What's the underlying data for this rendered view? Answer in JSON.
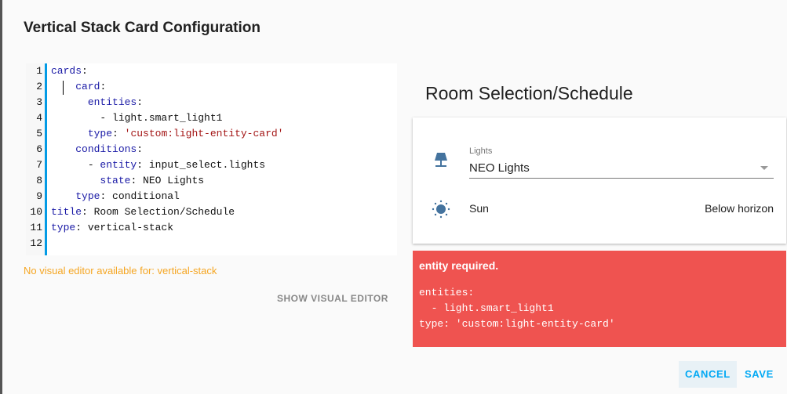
{
  "dialog": {
    "title": "Vertical Stack Card Configuration"
  },
  "editor": {
    "lines": [
      {
        "n": "1",
        "indent": "",
        "parts": [
          [
            "k",
            "cards"
          ],
          [
            "v",
            ":"
          ]
        ]
      },
      {
        "n": "2",
        "indent": "    ",
        "parts": [
          [
            "k",
            "card"
          ],
          [
            "v",
            ":"
          ]
        ]
      },
      {
        "n": "3",
        "indent": "      ",
        "parts": [
          [
            "k",
            "entities"
          ],
          [
            "v",
            ":"
          ]
        ]
      },
      {
        "n": "4",
        "indent": "        ",
        "parts": [
          [
            "v",
            "- light.smart_light1"
          ]
        ]
      },
      {
        "n": "5",
        "indent": "      ",
        "parts": [
          [
            "k",
            "type"
          ],
          [
            "v",
            ": "
          ],
          [
            "s",
            "'custom:light-entity-card'"
          ]
        ]
      },
      {
        "n": "6",
        "indent": "    ",
        "parts": [
          [
            "k",
            "conditions"
          ],
          [
            "v",
            ":"
          ]
        ]
      },
      {
        "n": "7",
        "indent": "      ",
        "parts": [
          [
            "v",
            "- "
          ],
          [
            "k",
            "entity"
          ],
          [
            "v",
            ": input_select.lights"
          ]
        ]
      },
      {
        "n": "8",
        "indent": "        ",
        "parts": [
          [
            "k",
            "state"
          ],
          [
            "v",
            ": NEO Lights"
          ]
        ]
      },
      {
        "n": "9",
        "indent": "    ",
        "parts": [
          [
            "k",
            "type"
          ],
          [
            "v",
            ": conditional"
          ]
        ]
      },
      {
        "n": "10",
        "indent": "",
        "parts": [
          [
            "k",
            "title"
          ],
          [
            "v",
            ": Room Selection/Schedule"
          ]
        ]
      },
      {
        "n": "11",
        "indent": "",
        "parts": [
          [
            "k",
            "type"
          ],
          [
            "v",
            ": vertical-stack"
          ]
        ]
      },
      {
        "n": "12",
        "indent": "",
        "parts": []
      }
    ]
  },
  "no_visual": "No visual editor available for: vertical-stack",
  "show_visual": "SHOW VISUAL EDITOR",
  "preview": {
    "title": "Room Selection/Schedule",
    "select_label": "Lights",
    "select_value": "NEO Lights",
    "sun_name": "Sun",
    "sun_state": "Below horizon"
  },
  "error": {
    "title": "entity required.",
    "code": "entities:\n  - light.smart_light1\ntype: 'custom:light-entity-card'"
  },
  "buttons": {
    "cancel": "CANCEL",
    "save": "SAVE"
  },
  "colors": {
    "accent": "#03a9f4",
    "error": "#ef5350",
    "icon": "#44739e"
  }
}
